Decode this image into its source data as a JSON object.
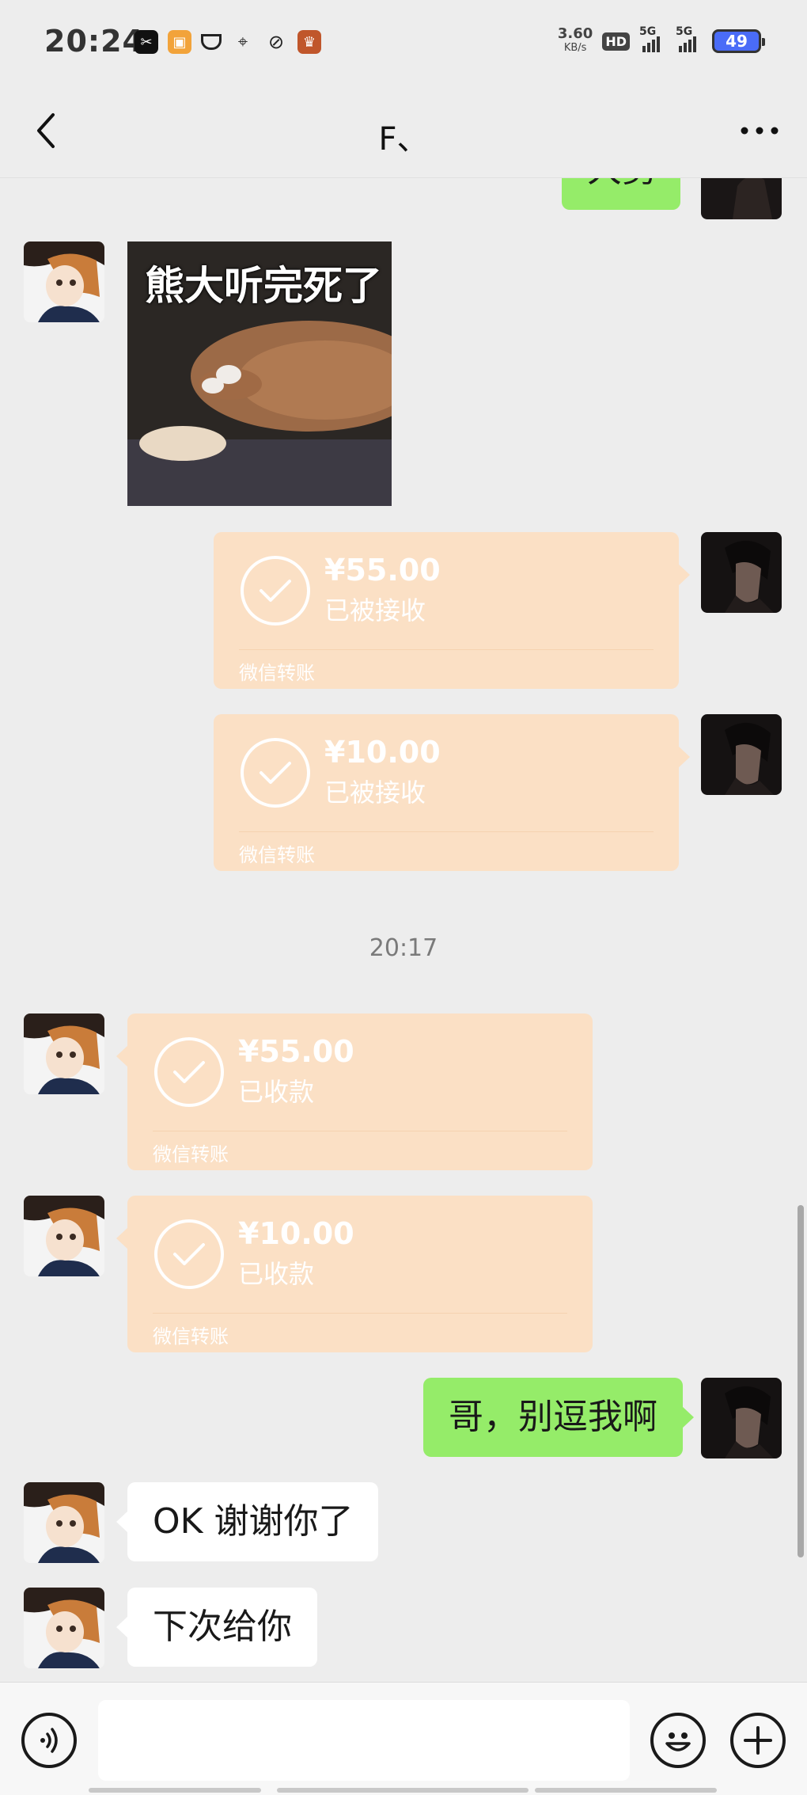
{
  "status_bar": {
    "time": "20:24",
    "net_speed_value": "3.60",
    "net_speed_unit": "KB/s",
    "hd_label": "HD",
    "signal_1": "5G",
    "signal_2": "5G",
    "battery": "49"
  },
  "nav": {
    "title": "F、"
  },
  "messages": {
    "partial_top_text": "大勇",
    "image_caption": "熊大听完死了",
    "transfer_out_1": {
      "amount": "¥55.00",
      "status": "已被接收",
      "footer": "微信转账"
    },
    "transfer_out_2": {
      "amount": "¥10.00",
      "status": "已被接收",
      "footer": "微信转账"
    },
    "timestamp": "20:17",
    "transfer_in_1": {
      "amount": "¥55.00",
      "status": "已收款",
      "footer": "微信转账"
    },
    "transfer_in_2": {
      "amount": "¥10.00",
      "status": "已收款",
      "footer": "微信转账"
    },
    "me_text_1": "哥，别逗我啊",
    "friend_text_1": "OK 谢谢你了",
    "friend_text_2": "下次给你"
  },
  "input_bar": {
    "placeholder": ""
  },
  "colors": {
    "background": "#ededed",
    "green_bubble": "#95ec69",
    "transfer_accepted": "#fbe0c5",
    "white_bubble": "#ffffff"
  },
  "icons": {
    "back": "chevron-left-icon",
    "more": "more-dots-icon",
    "voice": "voice-icon",
    "emoji": "emoji-icon",
    "add": "plus-icon",
    "transfer_check": "check-circle-icon"
  }
}
